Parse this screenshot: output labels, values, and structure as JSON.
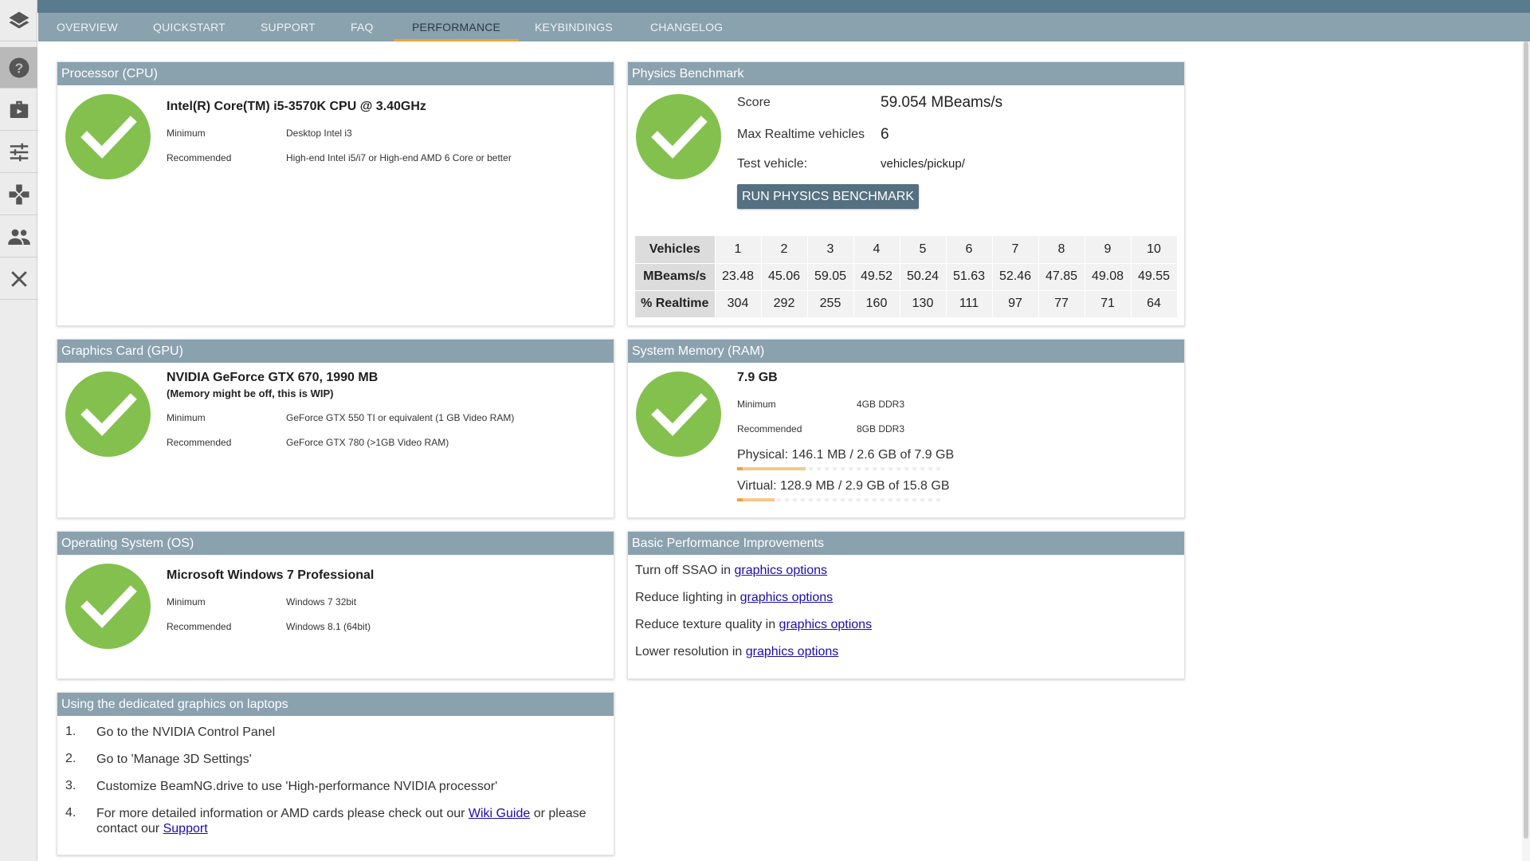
{
  "tabs": [
    "OVERVIEW",
    "QUICKSTART",
    "SUPPORT",
    "FAQ",
    "PERFORMANCE",
    "KEYBINDINGS",
    "CHANGELOG"
  ],
  "active_tab": "PERFORMANCE",
  "sidebar": [
    "layers-icon",
    "help-icon",
    "briefcase-icon",
    "sliders-icon",
    "gamepad-icon",
    "people-icon",
    "close-icon"
  ],
  "cpu": {
    "header": "Processor (CPU)",
    "title": "Intel(R) Core(TM) i5-3570K CPU @ 3.40GHz",
    "min_label": "Minimum",
    "min_value": "Desktop Intel i3",
    "rec_label": "Recommended",
    "rec_value": "High-end Intel i5/i7 or High-end AMD 6 Core or better"
  },
  "gpu": {
    "header": "Graphics Card (GPU)",
    "title": "NVIDIA GeForce GTX 670, 1990 MB",
    "note": "(Memory might be off, this is WIP)",
    "min_label": "Minimum",
    "min_value": "GeForce GTX 550 TI or equivalent (1 GB Video RAM)",
    "rec_label": "Recommended",
    "rec_value": "GeForce GTX 780 (>1GB Video RAM)"
  },
  "os": {
    "header": "Operating System (OS)",
    "title": "Microsoft Windows 7 Professional",
    "min_label": "Minimum",
    "min_value": "Windows 7 32bit",
    "rec_label": "Recommended",
    "rec_value": "Windows 8.1 (64bit)"
  },
  "physics": {
    "header": "Physics Benchmark",
    "score_label": "Score",
    "score_value": "59.054 MBeams/s",
    "maxrt_label": "Max Realtime vehicles",
    "maxrt_value": "6",
    "vehicle_label": "Test vehicle:",
    "vehicle_value": "vehicles/pickup/",
    "button": "RUN PHYSICS BENCHMARK",
    "table": {
      "row_headers": [
        "Vehicles",
        "MBeams/s",
        "% Realtime"
      ],
      "vehicles": [
        "1",
        "2",
        "3",
        "4",
        "5",
        "6",
        "7",
        "8",
        "9",
        "10"
      ],
      "mbeams": [
        "23.48",
        "45.06",
        "59.05",
        "49.52",
        "50.24",
        "51.63",
        "52.46",
        "47.85",
        "49.08",
        "49.55"
      ],
      "realtime": [
        "304",
        "292",
        "255",
        "160",
        "130",
        "111",
        "97",
        "77",
        "71",
        "64"
      ]
    }
  },
  "ram": {
    "header": "System Memory (RAM)",
    "title": "7.9 GB",
    "min_label": "Minimum",
    "min_value": "4GB DDR3",
    "rec_label": "Recommended",
    "rec_value": "8GB DDR3",
    "physical": "Physical: 146.1 MB / 2.6 GB of 7.9 GB",
    "physical_used_fraction": 0.33,
    "virtual": "Virtual: 128.9 MB / 2.9 GB of 15.8 GB",
    "virtual_used_fraction": 0.18
  },
  "tips": {
    "header": "Basic Performance Improvements",
    "items": [
      {
        "text": "Turn off SSAO in ",
        "link": "graphics options"
      },
      {
        "text": "Reduce lighting in ",
        "link": "graphics options"
      },
      {
        "text": "Reduce texture quality in ",
        "link": "graphics options"
      },
      {
        "text": "Lower resolution in ",
        "link": "graphics options"
      }
    ]
  },
  "laptop": {
    "header": "Using the dedicated graphics on laptops",
    "steps": [
      {
        "num": "1.",
        "text": "Go to the NVIDIA Control Panel"
      },
      {
        "num": "2.",
        "text": "Go to 'Manage 3D Settings'"
      },
      {
        "num": "3.",
        "text": "Customize BeamNG.drive to use 'High-performance NVIDIA processor'"
      },
      {
        "num": "4.",
        "text_a": "For more detailed information or AMD cards please check out our ",
        "link_a": "Wiki Guide",
        "text_b": " or please contact our ",
        "link_b": "Support"
      }
    ]
  },
  "colors": {
    "accent": "#f0a23b",
    "header": "#8aa1ae",
    "check": "#84c04e",
    "button": "#557080"
  }
}
